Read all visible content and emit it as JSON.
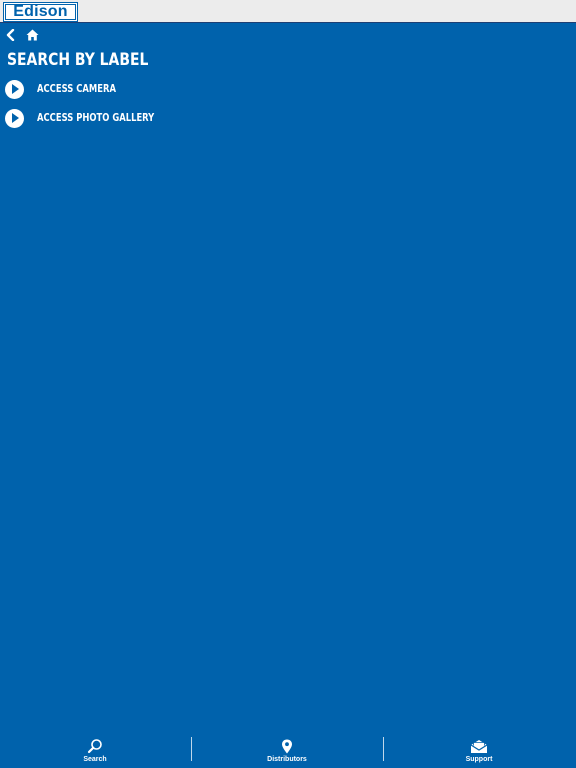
{
  "header": {
    "logo_text": "Edison",
    "background_color": "#ececec",
    "logo_color": "#0062ac"
  },
  "nav": {
    "back_icon": "chevron-left-icon",
    "home_icon": "home-icon"
  },
  "main": {
    "title": "SEARCH BY LABEL",
    "options": [
      {
        "label": "ACCESS CAMERA",
        "icon": "play-circle-icon"
      },
      {
        "label": "ACCESS PHOTO GALLERY",
        "icon": "play-circle-icon"
      }
    ],
    "background_color": "#0062ac"
  },
  "tabbar": {
    "tabs": [
      {
        "label": "Search",
        "icon": "search-icon"
      },
      {
        "label": "Distributors",
        "icon": "map-pin-icon"
      },
      {
        "label": "Support",
        "icon": "open-envelope-icon"
      }
    ]
  }
}
